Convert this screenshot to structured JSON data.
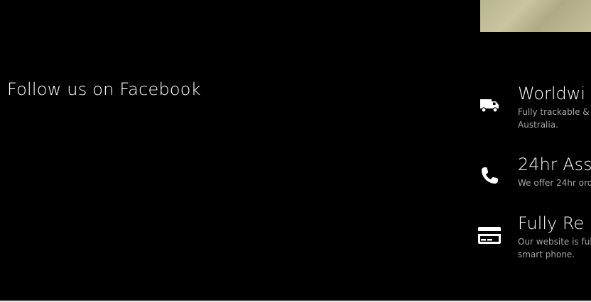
{
  "facebook": {
    "title": "Follow us on Facebook"
  },
  "features": [
    {
      "heading": "Worldwi",
      "desc": "Fully trackable & Australia.",
      "icon": "truck-icon"
    },
    {
      "heading": "24hr Ass",
      "desc": "We offer 24hr ord",
      "icon": "phone-icon"
    },
    {
      "heading": "Fully Re",
      "desc": "Our website is ful smart phone.",
      "icon": "credit-card-icon"
    }
  ],
  "colors": {
    "background": "#000000",
    "text": "#ffffff",
    "muted": "#a6a6a6"
  }
}
